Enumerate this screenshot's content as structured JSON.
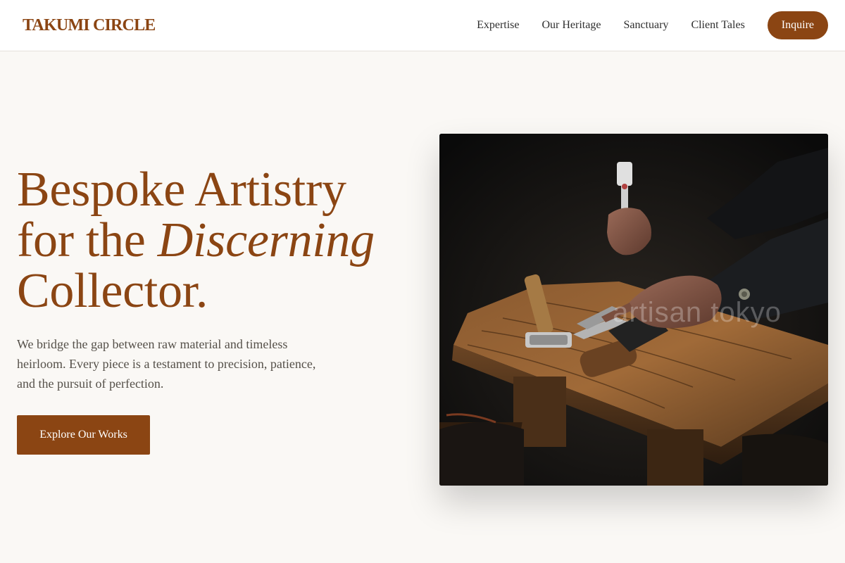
{
  "brand": {
    "name": "TAKUMI CIRCLE",
    "accent": "#8b4513"
  },
  "nav": {
    "links": [
      "Expertise",
      "Our Heritage",
      "Sanctuary",
      "Client Tales"
    ],
    "cta": "Inquire"
  },
  "hero": {
    "title_line1": "Bespoke Artistry",
    "title_line2_prefix": "for the ",
    "title_line2_italic": "Discerning",
    "title_line3": "Collector.",
    "description": "We bridge the gap between raw material and timeless heirloom. Every piece is a testament to precision, patience, and the pursuit of perfection.",
    "button": "Explore Our Works"
  },
  "image": {
    "subject": "artisan hands working with tools on a weathered wooden bench",
    "watermark": "artisan tokyo"
  }
}
